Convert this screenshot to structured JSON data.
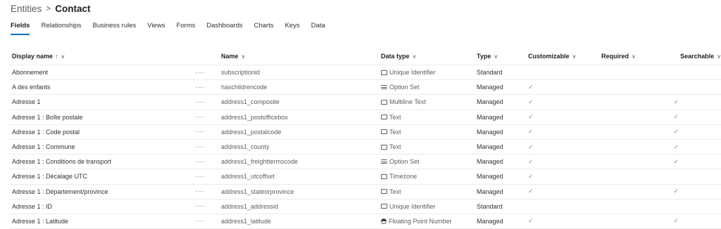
{
  "breadcrumb": {
    "root": "Entities",
    "separator": ">",
    "current": "Contact"
  },
  "tabs": [
    {
      "label": "Fields",
      "active": true
    },
    {
      "label": "Relationships"
    },
    {
      "label": "Business rules"
    },
    {
      "label": "Views"
    },
    {
      "label": "Forms"
    },
    {
      "label": "Dashboards"
    },
    {
      "label": "Charts"
    },
    {
      "label": "Keys"
    },
    {
      "label": "Data"
    }
  ],
  "columns": {
    "display_name": "Display name",
    "sort_arrow": "↑",
    "name": "Name",
    "data_type": "Data type",
    "type": "Type",
    "customizable": "Customizable",
    "required": "Required",
    "searchable": "Searchable",
    "chevron": "∨"
  },
  "more_glyph": "···",
  "check_glyph": "✓",
  "rows": [
    {
      "display": "Abonnement",
      "name": "subscriptionid",
      "dtype_icon": "unique-identifier-icon",
      "dtype": "Unique Identifier",
      "type": "Standard",
      "customizable": false,
      "searchable": false
    },
    {
      "display": "A des enfants",
      "name": "haschildrencode",
      "dtype_icon": "option-set-icon",
      "dtype": "Option Set",
      "type": "Managed",
      "customizable": true,
      "searchable": false
    },
    {
      "display": "Adresse 1",
      "name": "address1_composite",
      "dtype_icon": "multiline-text-icon",
      "dtype": "Multiline Text",
      "type": "Managed",
      "customizable": true,
      "searchable": true
    },
    {
      "display": "Adresse 1 : Boîte postale",
      "name": "address1_postofficebox",
      "dtype_icon": "text-icon",
      "dtype": "Text",
      "type": "Managed",
      "customizable": true,
      "searchable": true
    },
    {
      "display": "Adresse 1 : Code postal",
      "name": "address1_postalcode",
      "dtype_icon": "text-icon",
      "dtype": "Text",
      "type": "Managed",
      "customizable": true,
      "searchable": true
    },
    {
      "display": "Adresse 1 : Commune",
      "name": "address1_county",
      "dtype_icon": "text-icon",
      "dtype": "Text",
      "type": "Managed",
      "customizable": true,
      "searchable": true
    },
    {
      "display": "Adresse 1 : Conditions de transport",
      "name": "address1_freighttermscode",
      "dtype_icon": "option-set-icon",
      "dtype": "Option Set",
      "type": "Managed",
      "customizable": true,
      "searchable": true
    },
    {
      "display": "Adresse 1 : Décalage UTC",
      "name": "address1_utcoffset",
      "dtype_icon": "timezone-icon",
      "dtype": "Timezone",
      "type": "Managed",
      "customizable": true,
      "searchable": false
    },
    {
      "display": "Adresse 1 : Département/province",
      "name": "address1_stateorprovince",
      "dtype_icon": "text-icon",
      "dtype": "Text",
      "type": "Managed",
      "customizable": true,
      "searchable": true
    },
    {
      "display": "Adresse 1 : ID",
      "name": "address1_addressid",
      "dtype_icon": "unique-identifier-icon",
      "dtype": "Unique Identifier",
      "type": "Standard",
      "customizable": false,
      "searchable": false
    },
    {
      "display": "Adresse 1 : Latitude",
      "name": "address1_latitude",
      "dtype_icon": "floating-point-number-icon",
      "dtype": "Floating Point Number",
      "type": "Managed",
      "customizable": true,
      "searchable": true
    }
  ]
}
